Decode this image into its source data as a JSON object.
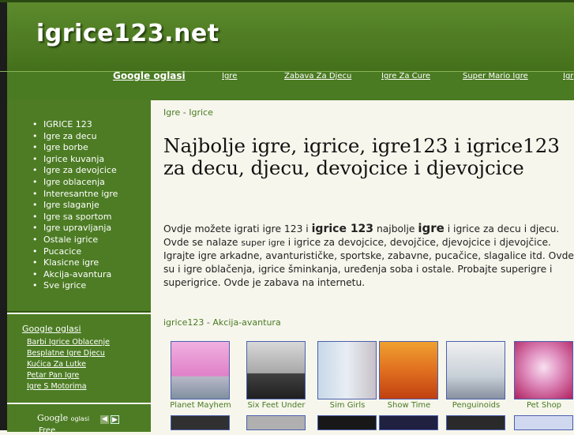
{
  "header": {
    "site_title": "igrice123.net"
  },
  "navbar": {
    "google": "Google oglasi",
    "links": [
      "Igre",
      "Zabava Za Djecu",
      "Igre Za Cure",
      "Super Mario Igre",
      "Igr"
    ]
  },
  "sidebar": {
    "menu": [
      "IGRICE 123",
      "Igre za decu",
      "Igre borbe",
      "Igrice kuvanja",
      "Igre za devojcice",
      "Igre oblacenja",
      "Interesantne igre",
      "Igre slaganje",
      "Igre sa sportom",
      "Igre upravljanja",
      "Ostale igrice",
      "Pucacice",
      "Klasicne igre",
      "Akcija-avantura",
      "Sve igrice"
    ],
    "ads_title": "Google oglasi",
    "ads": [
      "Barbi Igrice Oblacenje",
      "Besplatne Igre Djecu",
      "Kućica Za Lutke",
      "Petar Pan Igre",
      "Igre S Motorima"
    ],
    "google_logo": "Google",
    "google_logo_small": "oglasi",
    "free": "Free"
  },
  "content": {
    "breadcrumb": [
      "Igre",
      "Igrice"
    ],
    "breadcrumb_sep": " - ",
    "title": "Najbolje igre, igrice, igre123 i igrice123 za decu, djecu, devojcice i djevojcice",
    "intro": {
      "p1": "Ovdje možete igrati ",
      "p2": "igre 123",
      "p3": " i ",
      "p4": "igrice 123",
      "p5": " najbolje ",
      "p6": "igre",
      "p7": " i igrice za decu i djecu. Ovde se nalaze ",
      "p8": "super igre",
      "p9": " i igrice za devojcice, devojčice, djevojcice i djevojčice. Igrajte igre arkadne, avanturističke, sportske, zabavne, pucačice, slagalice itd. Ovde su i igre oblačenja, igrice šminkanja, uređenja soba i ostale. Probajte superigre i superigrice. Ovde je zabava na internetu."
    },
    "category_crumb": [
      "igrice123",
      "Akcija-avantura"
    ],
    "games": [
      "Planet Mayhem",
      "Six Feet Under",
      "Sim Girls",
      "Show Time",
      "Penguinoids",
      "Pet Shop"
    ]
  },
  "colors": {
    "header_green": "#5c8a2c",
    "sidebar_green": "#44701c",
    "link_green": "#4a7a22",
    "content_bg": "#f6f6ec"
  }
}
